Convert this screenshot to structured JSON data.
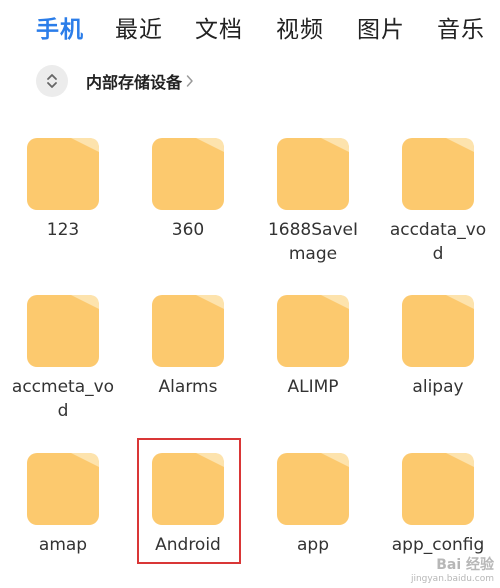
{
  "tabs": {
    "items": [
      {
        "label": "手机",
        "active": true
      },
      {
        "label": "最近",
        "active": false
      },
      {
        "label": "文档",
        "active": false
      },
      {
        "label": "视频",
        "active": false
      },
      {
        "label": "图片",
        "active": false
      },
      {
        "label": "音乐",
        "active": false
      }
    ]
  },
  "breadcrumb": {
    "location": "内部存储设备",
    "sort_icon": "sort-toggle-icon",
    "chevron_icon": "chevron-right-icon"
  },
  "folders": [
    {
      "name": "123"
    },
    {
      "name": "360"
    },
    {
      "name": "1688SaveImage"
    },
    {
      "name": "accdata_vod"
    },
    {
      "name": "accmeta_vod"
    },
    {
      "name": "Alarms"
    },
    {
      "name": "ALIMP"
    },
    {
      "name": "alipay"
    },
    {
      "name": "amap"
    },
    {
      "name": "Android",
      "highlighted": true
    },
    {
      "name": "app"
    },
    {
      "name": "app_config"
    }
  ],
  "colors": {
    "accent": "#2b7de9",
    "folder": "#fcc96e",
    "folder_fold": "#fde3ad",
    "highlight": "#d93636"
  },
  "watermark": {
    "brand": "Bai 经验",
    "url": "jingyan.baidu.com"
  }
}
